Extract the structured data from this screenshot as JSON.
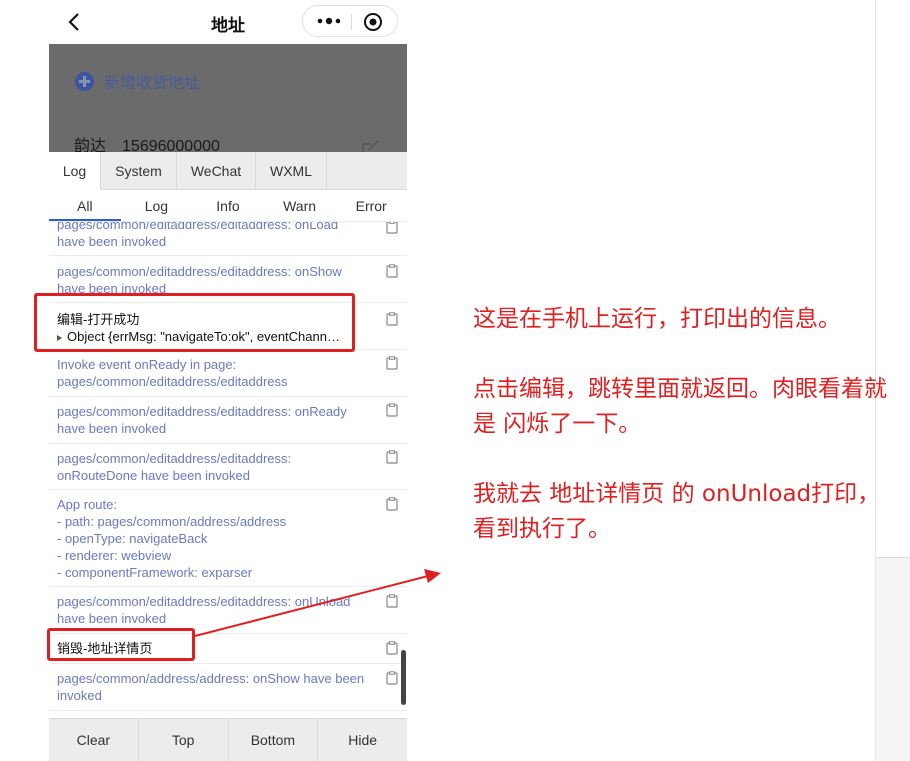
{
  "nav": {
    "title": "地址"
  },
  "page": {
    "add_label": "新增收货地址",
    "contact_name": "韵达",
    "contact_phone": "15696000000"
  },
  "vconsole": {
    "tabs": [
      "Log",
      "System",
      "WeChat",
      "WXML"
    ],
    "subtabs": [
      "All",
      "Log",
      "Info",
      "Warn",
      "Error"
    ],
    "logs": [
      {
        "text": "pages/common/editaddress/editaddress: onLoad\nhave been invoked"
      },
      {
        "text": "pages/common/editaddress/editaddress: onShow\nhave been invoked"
      },
      {
        "text": "编辑-打开成功",
        "object": "Object {errMsg: \"navigateTo:ok\", eventChann…"
      },
      {
        "text": "Invoke event onReady in page:\npages/common/editaddress/editaddress"
      },
      {
        "text": "pages/common/editaddress/editaddress: onReady\nhave been invoked"
      },
      {
        "text": "pages/common/editaddress/editaddress:\nonRouteDone have been invoked"
      },
      {
        "text": "App route:\n- path: pages/common/address/address\n- openType: navigateBack\n- renderer: webview\n- componentFramework: exparser"
      },
      {
        "text": "pages/common/editaddress/editaddress: onUnload\nhave been invoked"
      },
      {
        "text": "销毁-地址详情页"
      },
      {
        "text": "pages/common/address/address: onShow have been\ninvoked"
      }
    ],
    "footer": [
      "Clear",
      "Top",
      "Bottom",
      "Hide"
    ]
  },
  "annotations": {
    "p1": "这是在手机上运行，打印出的信息。",
    "p2": "点击编辑，跳转里面就返回。肉眼看着就是 闪烁了一下。",
    "p3": "我就去 地址详情页 的 onUnload打印，看到执行了。"
  },
  "colors": {
    "accent_red": "#e02020",
    "log_blue": "#6b78c2",
    "tab_active": "#2d5ec9"
  }
}
